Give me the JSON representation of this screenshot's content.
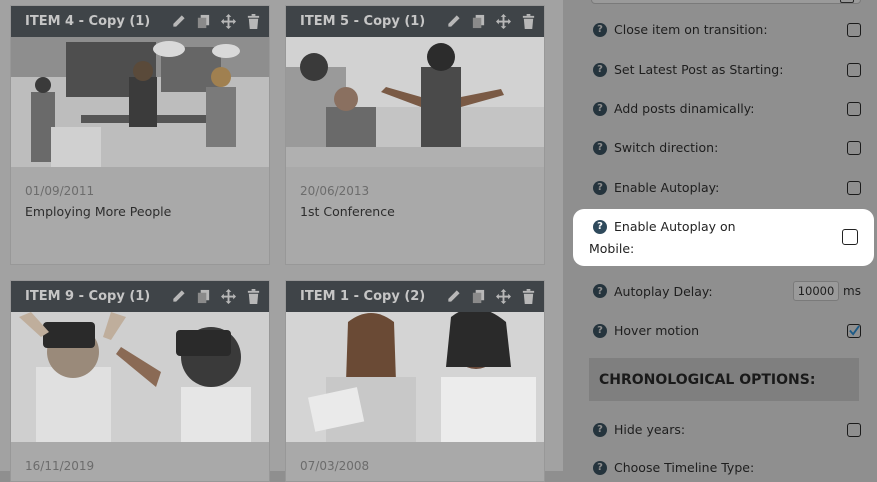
{
  "cards": [
    {
      "title": "ITEM 4 - Copy (1)",
      "date": "01/09/2011",
      "text": "Employing More People"
    },
    {
      "title": "ITEM 5 - Copy (1)",
      "date": "20/06/2013",
      "text": "1st Conference"
    },
    {
      "title": "ITEM 9 - Copy (1)",
      "date": "16/11/2019",
      "text": ""
    },
    {
      "title": "ITEM 1 - Copy (2)",
      "date": "07/03/2008",
      "text": ""
    }
  ],
  "options": {
    "close_item": {
      "label": "Close item on transition:",
      "checked": false
    },
    "latest_post": {
      "label": "Set Latest Post as Starting:",
      "checked": false
    },
    "add_posts": {
      "label": "Add posts dinamically:",
      "checked": false
    },
    "switch_direction": {
      "label": "Switch direction:",
      "checked": false
    },
    "enable_autoplay": {
      "label": "Enable Autoplay:",
      "checked": false
    },
    "autoplay_mobile": {
      "label_line1": "Enable Autoplay on",
      "label_line2": "Mobile:",
      "checked": false
    },
    "autoplay_delay": {
      "label": "Autoplay Delay:",
      "value": "10000",
      "unit": "ms"
    },
    "hover_motion": {
      "label": "Hover motion",
      "checked": true
    },
    "hide_years": {
      "label": "Hide years:",
      "checked": false
    },
    "timeline_type": {
      "label": "Choose Timeline Type:"
    }
  },
  "section": {
    "chronological": "CHRONOLOGICAL OPTIONS:"
  },
  "help_glyph": "?",
  "colors": {
    "overlay_dim": "#8f8f8f",
    "card_header": "#3f4448",
    "checkmark": "#1d5a86"
  }
}
